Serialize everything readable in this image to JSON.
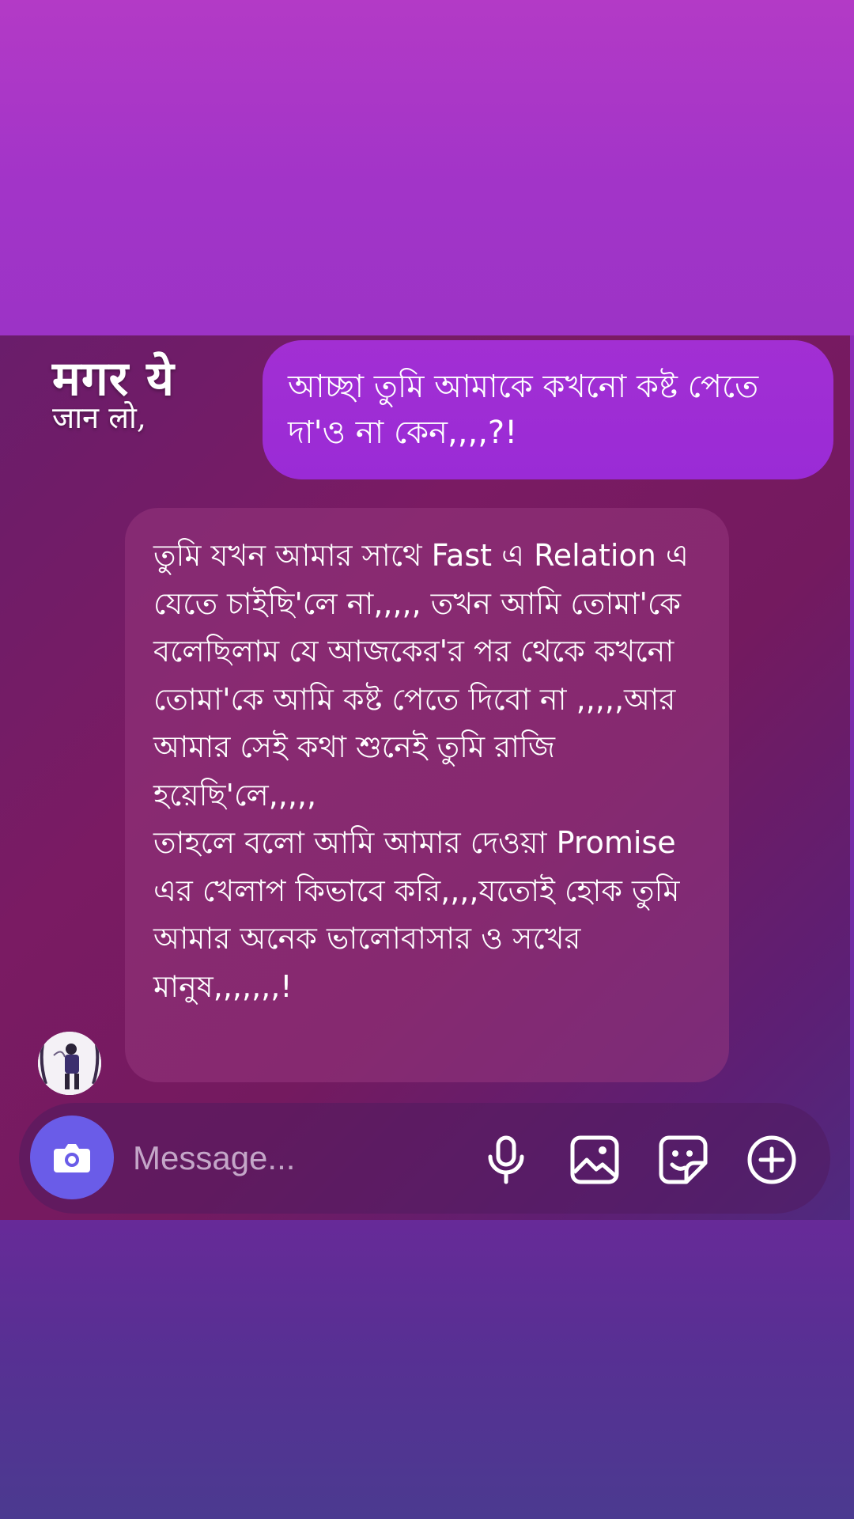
{
  "overlay": {
    "line1": "मगर ये",
    "line2": "जान लो,"
  },
  "messages": {
    "sent": {
      "text": "আচ্ছা তুমি আমাকে কখনো কষ্ট পেতে দা'ও না কেন,,,,?!"
    },
    "received": {
      "text": "তুমি যখন আমার সাথে Fast এ Relation এ যেতে চাইছি'লে না,,,,, তখন আমি তোমা'কে বলেছিলাম যে আজকের'র পর থেকে কখনো তোমা'কে আমি কষ্ট পেতে দিবো না ,,,,,আর আমার সেই কথা শুনেই তুমি রাজি হয়েছি'লে,,,,,\nতাহলে বলো আমি আমার দেওয়া Promise এর খেলাপ কিভাবে করি,,,,যতোই হোক তুমি আমার অনেক ভালোবাসার ও সখের মানুষ,,,,,,,!"
    }
  },
  "composer": {
    "placeholder": "Message...",
    "icons": [
      "camera-icon",
      "microphone-icon",
      "gallery-icon",
      "sticker-icon",
      "plus-icon"
    ]
  },
  "colors": {
    "background_top": "#b33ac6",
    "chat_panel": "#741a5f",
    "sent_bubble": "#9a2bd6",
    "camera_button": "#6a5ce8",
    "background_bottom": "#4b3a90"
  }
}
